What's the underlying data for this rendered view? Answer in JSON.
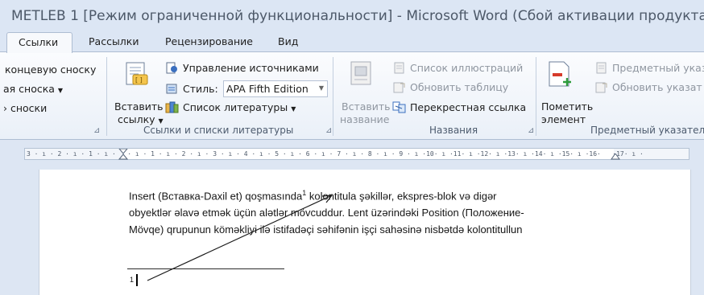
{
  "window": {
    "title": "METLEB 1 [Режим ограниченной функциональности]  -  Microsoft Word (Сбой активации продукта)"
  },
  "tabs": [
    "Ссылки",
    "Рассылки",
    "Рецензирование",
    "Вид"
  ],
  "ribbon": {
    "footnotes": {
      "item1": "концевую сноску",
      "item2": "ая сноска",
      "item3": "› сноски"
    },
    "citations": {
      "insert_label_1": "Вставить",
      "insert_label_2": "ссылку",
      "manage_sources": "Управление источниками",
      "style_label": "Стиль:",
      "style_value": "APA Fifth Edition",
      "bibliography": "Список литературы",
      "group_label": "Ссылки и списки литературы"
    },
    "captions": {
      "insert_label_1": "Вставить",
      "insert_label_2": "название",
      "list_of_figures": "Список иллюстраций",
      "update_table": "Обновить таблицу",
      "cross_reference": "Перекрестная ссылка",
      "group_label": "Названия"
    },
    "index": {
      "mark_label_1": "Пометить",
      "mark_label_2": "элемент",
      "subject_index": "Предметный указ",
      "update_index": "Обновить указат",
      "group_label": "Предметный указатель"
    }
  },
  "ruler": {
    "ticks": "3 · ı · 2 · ı · 1 · ı ·   · ı · 1 · ı · 2 · ı · 3 · ı · 4 · ı · 5 · ı · 6 · ı · 7 · ı · 8 · ı · 9 · ı ·10· ı ·11· ı ·12· ı ·13· ı ·14· ı ·15· ı ·16·   ·17· ı ·"
  },
  "document": {
    "line1_a": "Insert (Вставка-Daxil et) qoşmasında",
    "line1_sup": "1",
    "line1_b": " kolontitula şəkillər, ekspres-blok və digər",
    "line2": "obyektlər əlavə etmək üçün alətlər mövcuddur. Lent üzərindəki Position (Положение-",
    "line3": "Mövqe) qrupunun köməkliyi ilə istifadəçi səhifənin işçi sahəsinə nisbətdə kolontitullun",
    "footnote_number": "1"
  }
}
